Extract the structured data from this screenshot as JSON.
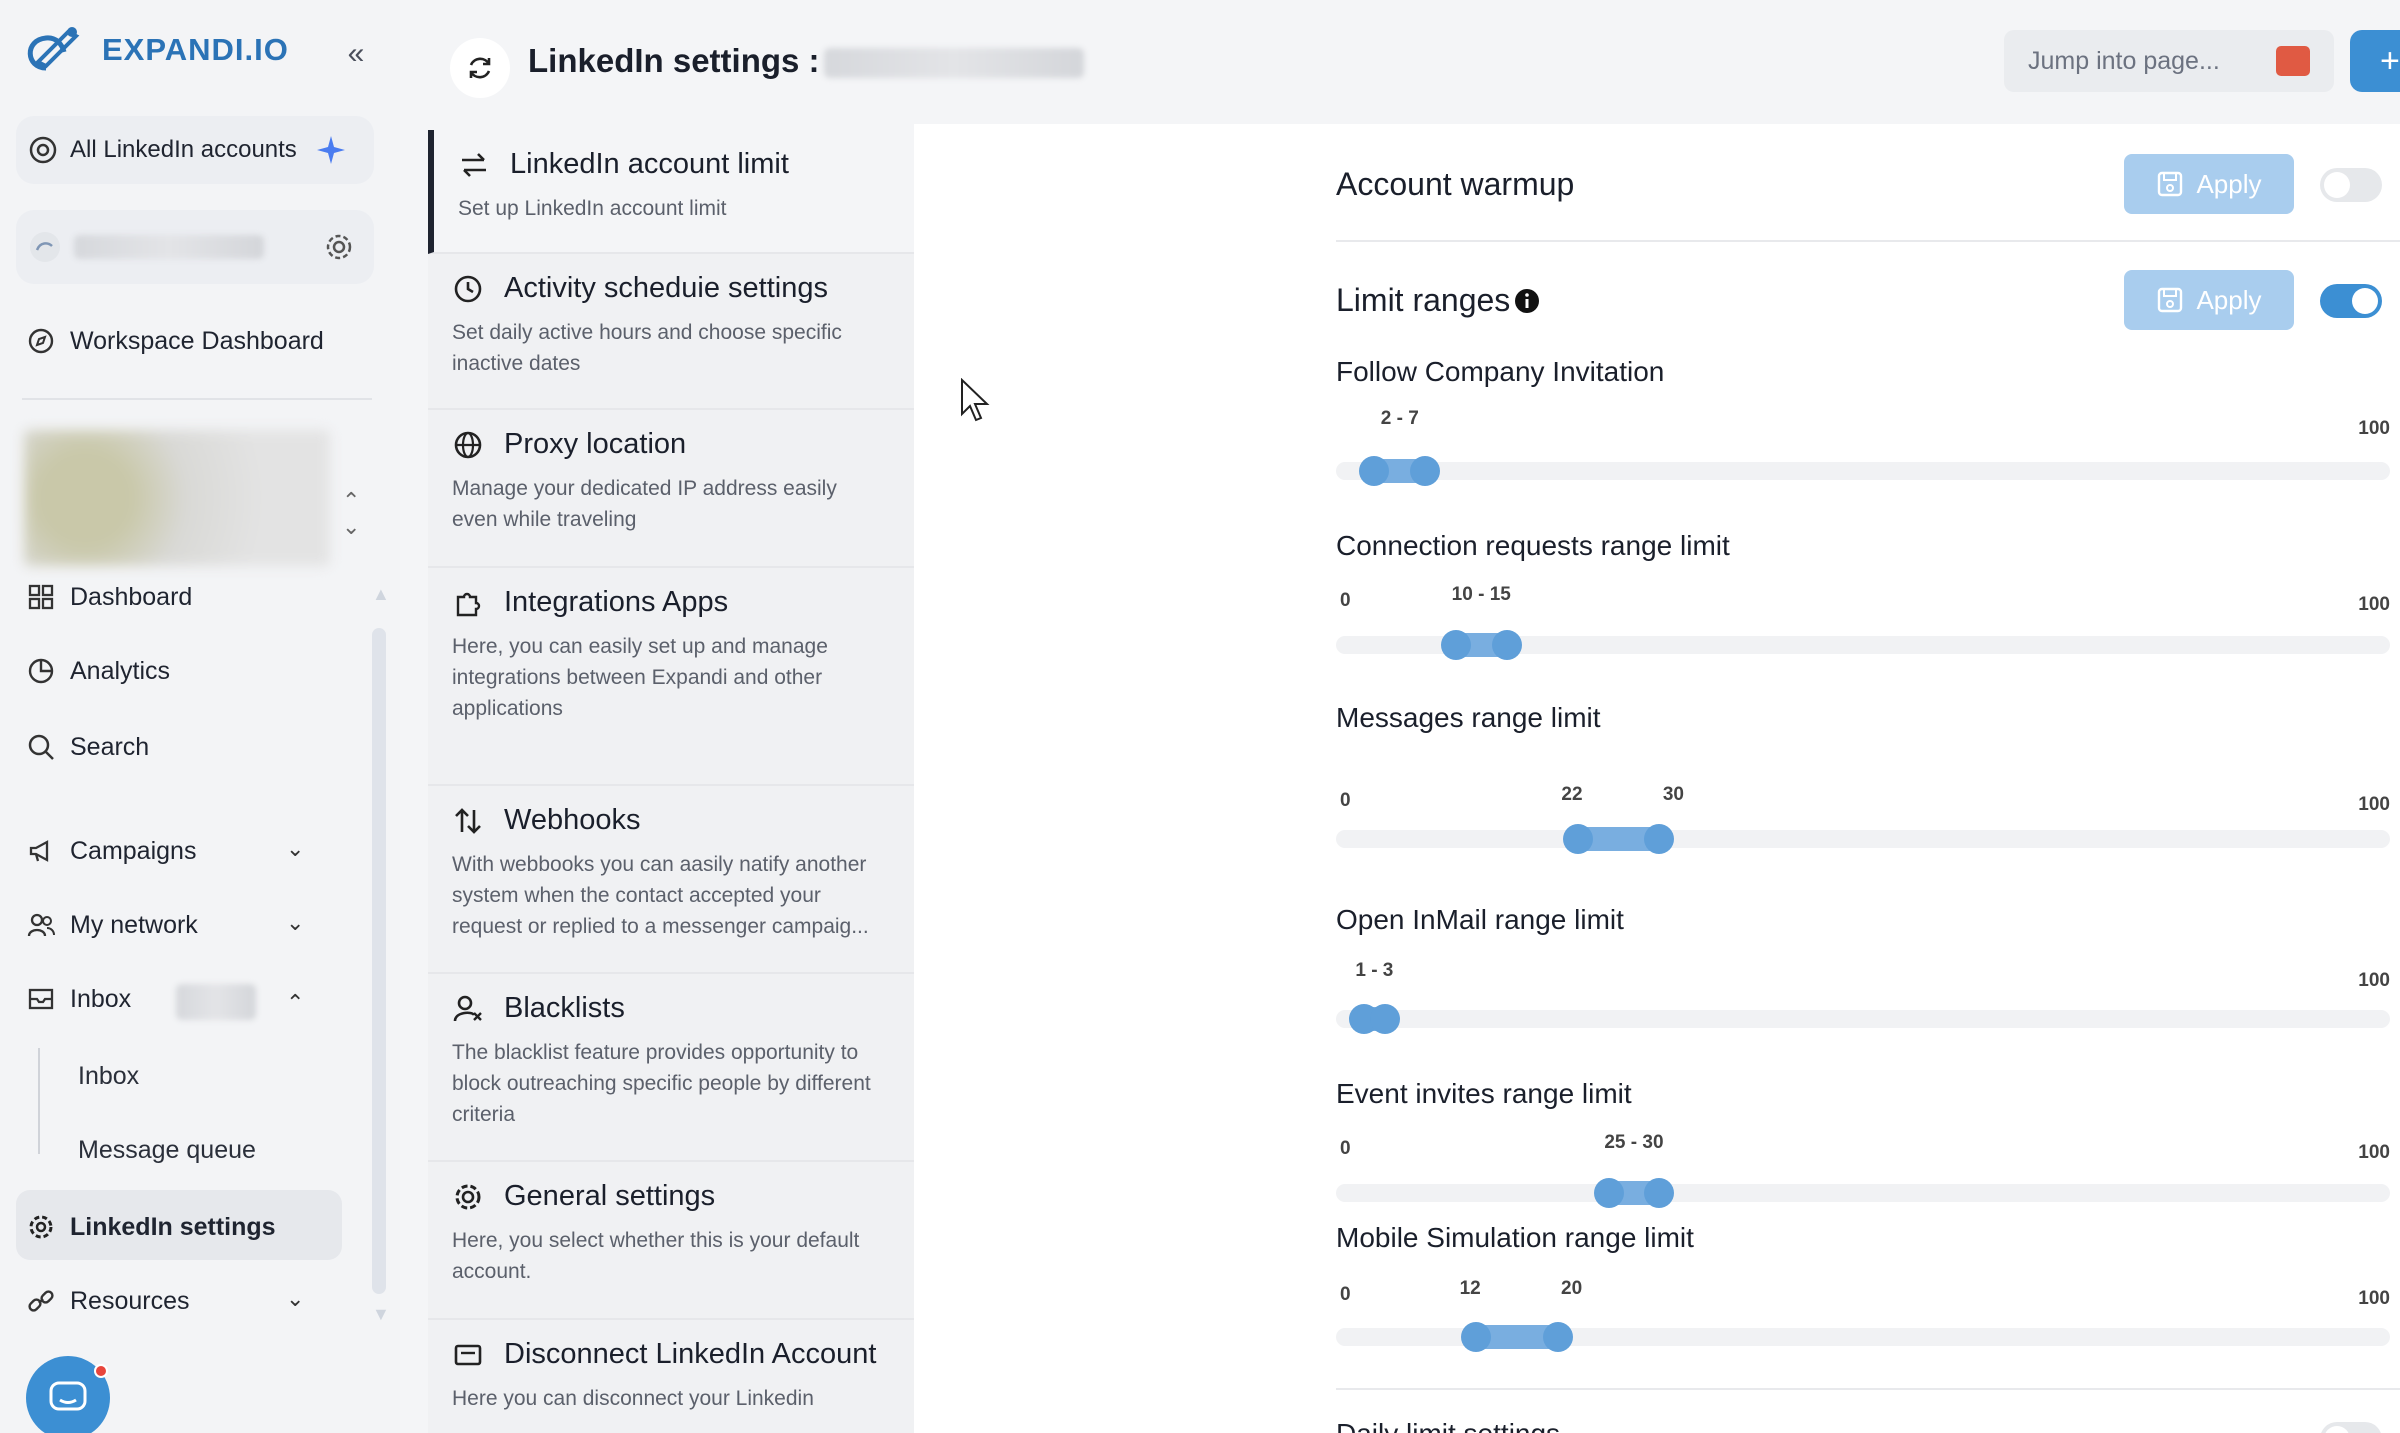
{
  "brand": {
    "name": "EXPANDI.IO"
  },
  "sidebar": {
    "all_accounts": "All LinkedIn accounts",
    "workspace_dashboard": "Workspace Dashboard",
    "nav": {
      "dashboard": "Dashboard",
      "analytics": "Analytics",
      "search": "Search",
      "campaigns": "Campaigns",
      "my_network": "My network",
      "inbox": "Inbox",
      "inbox_sub": "Inbox",
      "message_queue": "Message queue",
      "linkedin_settings": "LinkedIn settings",
      "resources": "Resources"
    }
  },
  "header": {
    "title": "LinkedIn settings :",
    "jump_placeholder": "Jump into page..."
  },
  "menu": [
    {
      "title": "LinkedIn account limit",
      "desc": "Set up LinkedIn account limit"
    },
    {
      "title": "Activity scheduie settings",
      "desc": "Set daily active hours and choose specific inactive dates"
    },
    {
      "title": "Proxy location",
      "desc": "Manage your dedicated IP address easily even while traveling"
    },
    {
      "title": "Integrations Apps",
      "desc": "Here, you can easily set up and manage integrations between Expandi and other applications"
    },
    {
      "title": "Webhooks",
      "desc": "With webbooks you can aasily natify another system when the contact accepted your request or replied to a messenger campaig..."
    },
    {
      "title": "Blacklists",
      "desc": "The blacklist feature provides opportunity to block outreaching specific people by different criteria"
    },
    {
      "title": "General settings",
      "desc": "Here, you select whether this is your default account."
    },
    {
      "title": "Disconnect LinkedIn Account",
      "desc": "Here you can disconnect your Linkedin"
    }
  ],
  "content": {
    "warmup": {
      "title": "Account warmup",
      "apply": "Apply",
      "enabled": false
    },
    "limits": {
      "title": "Limit ranges",
      "apply": "Apply",
      "enabled": true
    },
    "sliders": [
      {
        "label": "Follow Company Invitation",
        "min": "",
        "max": "100",
        "low": 2,
        "high": 7,
        "value_label": "2 - 7",
        "split": false
      },
      {
        "label": "Connection requests range limit",
        "min": "0",
        "max": "100",
        "low": 10,
        "high": 15,
        "value_label": "10 - 15",
        "split": false
      },
      {
        "label": "Messages range limit",
        "min": "0",
        "max": "100",
        "low": 22,
        "high": 30,
        "low_label": "22",
        "high_label": "30",
        "split": true
      },
      {
        "label": "Open InMail range limit",
        "min": "",
        "max": "100",
        "low": 1,
        "high": 3,
        "value_label": "1 - 3",
        "split": false
      },
      {
        "label": "Event invites range limit",
        "min": "0",
        "max": "100",
        "low": 25,
        "high": 30,
        "value_label": "25 - 30",
        "split": false
      },
      {
        "label": "Mobile Simulation range limit",
        "min": "0",
        "max": "100",
        "low": 12,
        "high": 20,
        "low_label": "12",
        "high_label": "20",
        "split": true
      }
    ],
    "next_section": "Daily limit settings"
  },
  "colors": {
    "accent": "#3c8fd3",
    "apply_bg": "#a9cdee",
    "range": "#79aee0"
  }
}
